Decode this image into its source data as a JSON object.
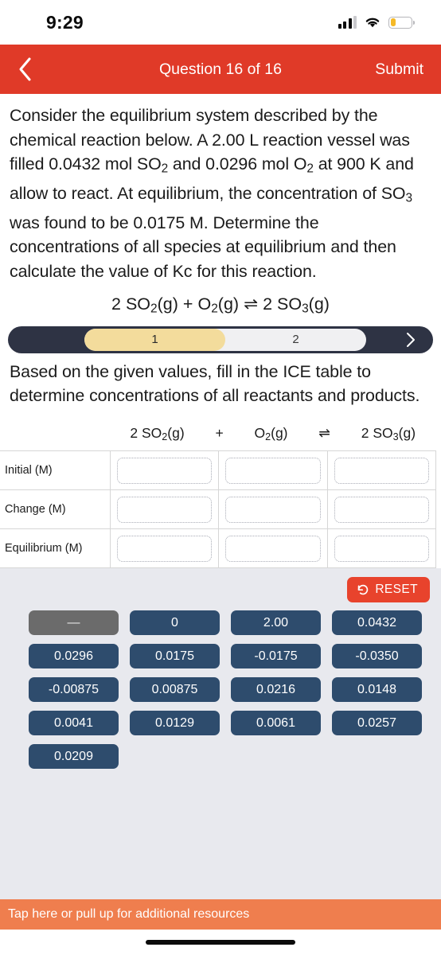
{
  "status_bar": {
    "time": "9:29",
    "signal_icon": "cellular-signal-icon",
    "wifi_icon": "wifi-icon",
    "battery_icon": "battery-low-icon",
    "battery_level_percent": 25
  },
  "nav_bar": {
    "back_icon": "chevron-left-icon",
    "title": "Question 16 of 16",
    "submit_label": "Submit",
    "color": "#E03A28"
  },
  "question": {
    "body_part_1": "Consider the equilibrium system described by the chemical reaction below. A 2.00 L reaction vessel was filled 0.0432 mol SO",
    "body_part_2": " and 0.0296 mol O",
    "body_part_3": " at 900 K and allow to react. At equilibrium, the concentration of SO",
    "body_part_4": " was found to be 0.0175 M. Determine the concentrations of all species at equilibrium and then calculate the value of Kc for this reaction.",
    "sub_2a": "2",
    "sub_2b": "2",
    "sub_3": "3",
    "equation": {
      "coeff_so2": "2 SO",
      "sub_so2": "2",
      "state_so2": "(g)",
      "plus": "+",
      "o2": "O",
      "sub_o2": "2",
      "state_o2": "(g)",
      "equilibrium_arrow": "⇌",
      "coeff_so3": "2 SO",
      "sub_so3": "3",
      "state_so3": "(g)"
    }
  },
  "pager": {
    "segments": [
      {
        "label": "1",
        "active": true
      },
      {
        "label": "2",
        "active": false
      }
    ],
    "next_icon": "chevron-right-icon",
    "bar_color": "#2E3344",
    "active_color": "#F3DC9C"
  },
  "instruction": "Based on the given values, fill in the ICE table to determine concentrations of all reactants and products.",
  "ice_table": {
    "header": {
      "corner_label": "",
      "species": [
        {
          "coeff": "2 SO",
          "sub": "2",
          "state": "(g)"
        },
        {
          "coeff": "",
          "sub": "2",
          "state": "(g)",
          "element": "O"
        },
        {
          "coeff": "2 SO",
          "sub": "3",
          "state": "(g)"
        }
      ],
      "operator_plus": "+",
      "operator_arrow": "⇌"
    },
    "rows": [
      {
        "label": "Initial (M)",
        "cells": [
          "",
          "",
          ""
        ]
      },
      {
        "label": "Change (M)",
        "cells": [
          "",
          "",
          ""
        ]
      },
      {
        "label": "Equilibrium (M)",
        "cells": [
          "",
          "",
          ""
        ]
      }
    ]
  },
  "tray": {
    "reset_label": "RESET",
    "reset_icon": "rotate-ccw-icon",
    "reset_color": "#E8432C",
    "token_color": "#2E4C6D",
    "placeholder_color": "#6B6B6B",
    "tokens": [
      {
        "label": "—",
        "placeholder": true
      },
      {
        "label": "0",
        "placeholder": false
      },
      {
        "label": "2.00",
        "placeholder": false
      },
      {
        "label": "0.0432",
        "placeholder": false
      },
      {
        "label": "0.0296",
        "placeholder": false
      },
      {
        "label": "0.0175",
        "placeholder": false
      },
      {
        "label": "-0.0175",
        "placeholder": false
      },
      {
        "label": "-0.0350",
        "placeholder": false
      },
      {
        "label": "-0.00875",
        "placeholder": false
      },
      {
        "label": "0.00875",
        "placeholder": false
      },
      {
        "label": "0.0216",
        "placeholder": false
      },
      {
        "label": "0.0148",
        "placeholder": false
      },
      {
        "label": "0.0041",
        "placeholder": false
      },
      {
        "label": "0.0129",
        "placeholder": false
      },
      {
        "label": "0.0061",
        "placeholder": false
      },
      {
        "label": "0.0257",
        "placeholder": false
      },
      {
        "label": "0.0209",
        "placeholder": false
      }
    ]
  },
  "resource_bar": {
    "label": "Tap here or pull up for additional resources",
    "color": "#EF7E4E"
  }
}
